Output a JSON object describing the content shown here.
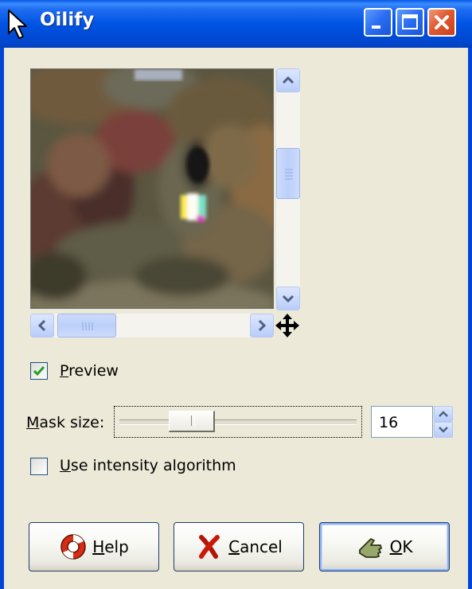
{
  "window": {
    "title": "Oilify"
  },
  "preview": {
    "checkbox_checked": true,
    "label_mnemonic": "P",
    "label_rest": "review"
  },
  "mask_size": {
    "label_mnemonic": "M",
    "label_rest": "ask size:",
    "value": "16"
  },
  "intensity": {
    "checkbox_checked": false,
    "label_mnemonic": "U",
    "label_rest": "se intensity algorithm"
  },
  "buttons": {
    "help": {
      "mnemonic": "H",
      "rest": "elp"
    },
    "cancel": {
      "mnemonic": "C",
      "rest": "ancel"
    },
    "ok": {
      "mnemonic": "O",
      "rest": "K"
    }
  },
  "colors": {
    "titlebar": "#0054e3",
    "dialog_bg": "#ece9d8",
    "close_button": "#e05a30",
    "checkmark": "#21a121"
  },
  "icons": [
    "pointer-icon",
    "minimize-icon",
    "maximize-icon",
    "close-icon",
    "navigate-icon",
    "help-lifebuoy-icon",
    "cancel-x-icon",
    "ok-hand-icon"
  ]
}
